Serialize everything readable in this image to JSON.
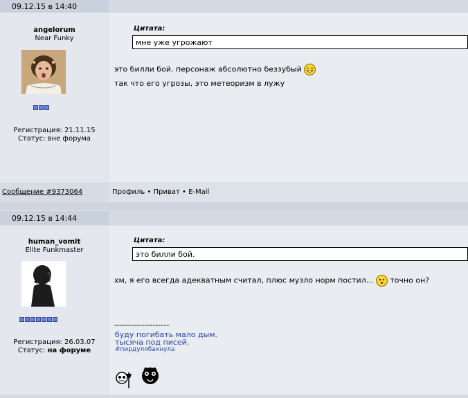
{
  "posts": [
    {
      "date": "09.12.15 в 14:40",
      "author": "angelorum",
      "rank": "Near Funky",
      "stars": 3,
      "registration": "Регистрация: 21.11.15",
      "status_label": "Статус:",
      "status_value": "вне форума",
      "quote_label": "Цитата:",
      "quote_text": "мне уже угрожают",
      "message_lines": [
        "это билли бой. персонаж абсолютно беззубый",
        "так что его угрозы, это метеоризм в лужу"
      ],
      "message_link": "Сообщение #9373064",
      "actions": [
        "Профиль",
        "Приват",
        "E-Mail"
      ]
    },
    {
      "date": "09.12.15 в 14:44",
      "author": "human_vomit",
      "rank": "Elite Funkmaster",
      "stars": 7,
      "registration": "Регистрация: 26.03.07",
      "status_label": "Статус:",
      "status_value": "на форуме",
      "quote_label": "Цитата:",
      "quote_text": "это билли бой.",
      "message_text": "хм, я его всегда адекватным считал, плюс музло норм постил...",
      "message_tail": "точно он?",
      "signature_divider": "--------------------",
      "signature_lines": [
        "буду погибать мало дым.",
        "тысяча под писей.",
        "#пирдулябахнула"
      ]
    }
  ],
  "actions_separator": " • ",
  "colors": {
    "signature": "#2b44a8",
    "header": "#c9d1dc",
    "body": "#e9ecf0"
  }
}
